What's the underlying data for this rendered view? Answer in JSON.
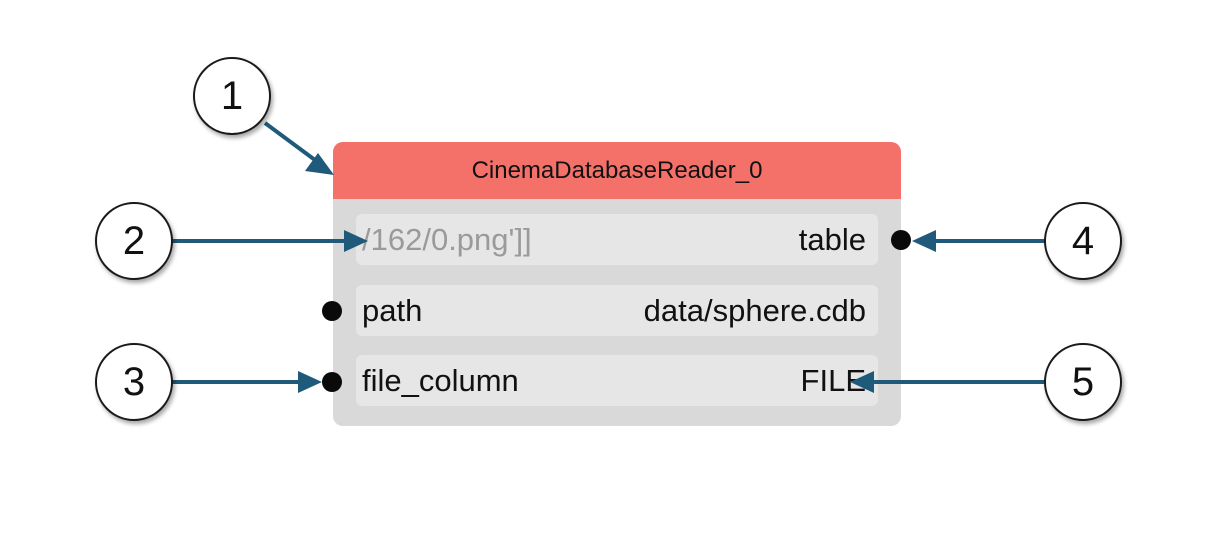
{
  "node": {
    "title": "CinemaDatabaseReader_0",
    "output_preview": "/162/0.png']]",
    "output_port_label": "table",
    "path_label": "path",
    "path_value": "data/sphere.cdb",
    "file_column_label": "file_column",
    "file_column_value": "FILE"
  },
  "callouts": [
    "1",
    "2",
    "3",
    "4",
    "5"
  ],
  "colors": {
    "header": "#f4716a",
    "node_body": "#d9d9d9",
    "row": "#e6e6e6",
    "arrow": "#1f5a7a",
    "port": "#0a0a0a"
  }
}
